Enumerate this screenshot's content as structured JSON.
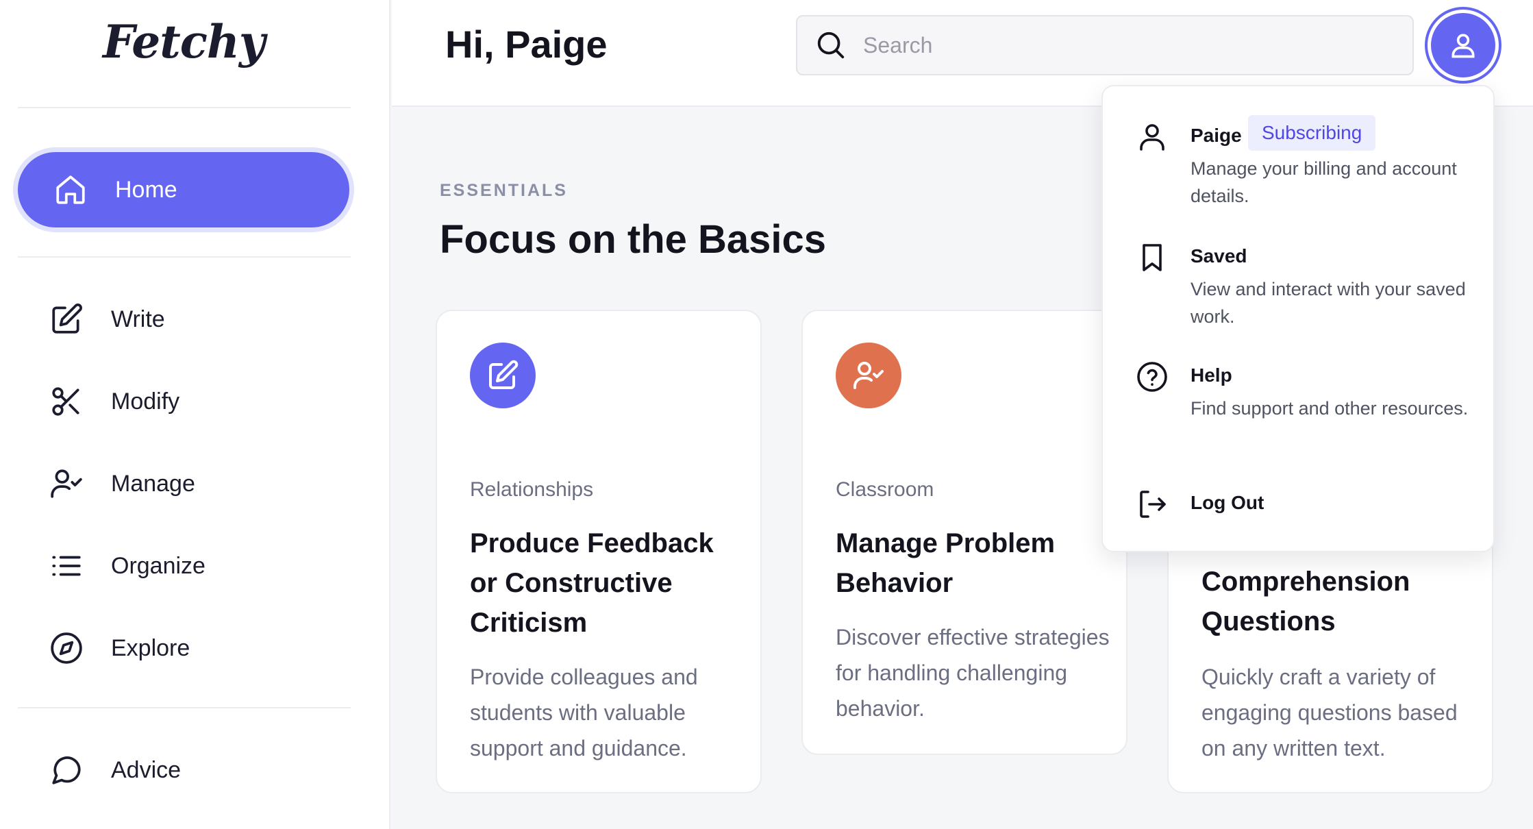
{
  "app": {
    "logo": "Fetchy"
  },
  "sidebar": {
    "home": {
      "label": "Home"
    },
    "items": [
      {
        "label": "Write",
        "icon": "pencil-square-icon"
      },
      {
        "label": "Modify",
        "icon": "scissors-icon"
      },
      {
        "label": "Manage",
        "icon": "user-check-icon"
      },
      {
        "label": "Organize",
        "icon": "list-icon"
      },
      {
        "label": "Explore",
        "icon": "compass-icon"
      }
    ],
    "advice": {
      "label": "Advice",
      "icon": "chat-bubble-icon"
    }
  },
  "header": {
    "greeting": "Hi, Paige",
    "search": {
      "placeholder": "Search",
      "value": ""
    }
  },
  "main": {
    "eyebrow": "ESSENTIALS",
    "title": "Focus on the Basics",
    "cards": [
      {
        "category": "Relationships",
        "title": "Produce Feedback or Constructive Criticism",
        "description": "Provide colleagues and students with valuable support and guidance.",
        "icon": "pencil-square-icon",
        "color": "#6466f1"
      },
      {
        "category": "Classroom",
        "title": "Manage Problem Behavior",
        "description": "Discover effective strategies for handling challenging behavior.",
        "icon": "user-check-icon",
        "color": "#e0714f"
      },
      {
        "category": "",
        "title": "Comprehension Questions",
        "description": "Quickly craft a variety of engaging questions based on any written text.",
        "icon": "",
        "color": ""
      }
    ]
  },
  "dropdown": {
    "profile": {
      "name": "Paige",
      "badge": "Subscribing",
      "description": "Manage your billing and account details."
    },
    "saved": {
      "title": "Saved",
      "description": "View and interact with your saved work."
    },
    "help": {
      "title": "Help",
      "description": "Find support and other resources."
    },
    "logout": {
      "title": "Log Out"
    }
  },
  "colors": {
    "accent": "#6466f1",
    "accent_ring": "#e1e2fb",
    "orange": "#e0714f",
    "badge_bg": "#eceefe",
    "badge_text": "#4f46e5"
  }
}
